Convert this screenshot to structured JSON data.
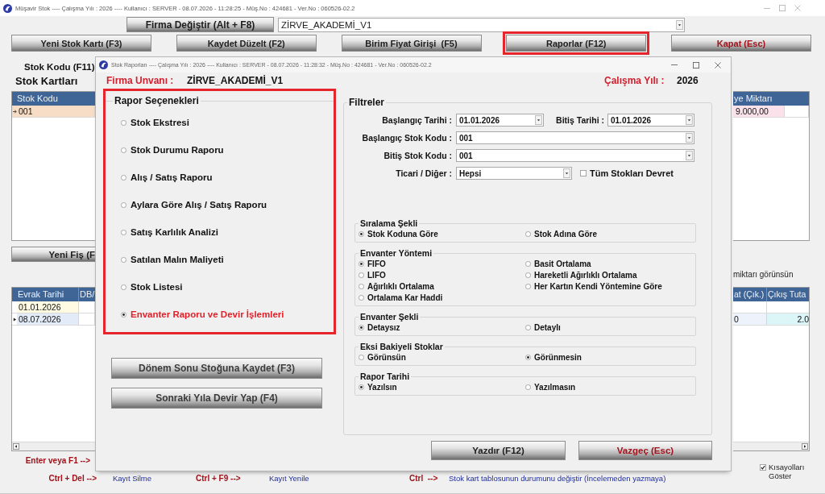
{
  "window": {
    "title": "Müşavir Stok ---- Çalışma Yılı : 2026 ---- Kullanıcı : SERVER - 08.07.2026 - 11:28:25 - Müş.No : 424681 - Ver.No : 060526-02.2"
  },
  "company_bar": {
    "button": "Firma Değiştir (Alt + F8)",
    "company": "ZİRVE_AKADEMİ_V1"
  },
  "toolbar": [
    {
      "label": "Yeni Stok Kartı (F3)",
      "kind": "normal",
      "highlighted": false
    },
    {
      "label": "Kaydet Düzelt (F2)",
      "kind": "normal",
      "highlighted": false
    },
    {
      "label": "Birim Fiyat Girişi  (F5)",
      "kind": "normal",
      "highlighted": false
    },
    {
      "label": "Raporlar (F12)",
      "kind": "normal",
      "highlighted": true
    },
    {
      "label": "Kapat (Esc)",
      "kind": "danger",
      "highlighted": false
    }
  ],
  "stock_code_label": "Stok Kodu (F11)",
  "cards": {
    "title": "Stok Kartları",
    "columns": [
      "Stok Kodu",
      "ye Miktarı"
    ],
    "rows": [
      {
        "cells": [
          "001",
          "9.000,00"
        ],
        "selected": true
      }
    ]
  },
  "new_receipt_button": "Yeni Fiş (F",
  "show_quantity_label": "miktarı görünsün",
  "movements": {
    "columns": [
      "Evrak Tarihi",
      "DB/",
      "at (Çık.)",
      "Çıkış Tuta"
    ],
    "rows": [
      {
        "evrak_tarihi": "01.01.2026",
        "selected": false
      },
      {
        "evrak_tarihi": "08.07.2026",
        "column_3": "0",
        "column_4": "2.0",
        "selected": true
      }
    ]
  },
  "shortcuts": {
    "enter_hint": "Enter veya F1 -->",
    "items": [
      {
        "keys": "Ctrl + Del -->",
        "action": "Kayıt Silme"
      },
      {
        "keys": "Ctrl + F9 -->",
        "action": "Kayıt Yenile"
      },
      {
        "keys": "Ctrl  -->",
        "action": "Stok kart tablosunun durumunu değiştir (İncelemeden yazmaya)"
      }
    ],
    "show_checkbox": {
      "label": "Kısayolları Göster",
      "checked": true
    }
  },
  "dialog": {
    "title": "Stok Raporları ---- Çalışma Yılı : 2026 ---- Kullanıcı : SERVER - 08.07.2026 - 11:28:32 - Müş.No : 424681 - Ver.No : 060526-02.2",
    "company_label": "Firma Unvanı :",
    "company": "ZİRVE_AKADEMİ_V1",
    "year_label": "Çalışma Yılı :",
    "year": "2026",
    "report_options": {
      "title": "Rapor Seçenekleri",
      "highlighted": true,
      "items": [
        {
          "label": "Stok Ekstresi",
          "selected": false
        },
        {
          "label": "Stok Durumu Raporu",
          "selected": false
        },
        {
          "label": "Alış / Satış Raporu",
          "selected": false
        },
        {
          "label": "Aylara Göre Alış / Satış Raporu",
          "selected": false
        },
        {
          "label": "Satış Karlılık Analizi",
          "selected": false
        },
        {
          "label": "Satılan Malın Maliyeti",
          "selected": false
        },
        {
          "label": "Stok Listesi",
          "selected": false
        },
        {
          "label": "Envanter Raporu ve Devir İşlemleri",
          "selected": true
        }
      ]
    },
    "actions": [
      "Dönem Sonu Stoğuna Kaydet (F3)",
      "Sonraki Yıla Devir Yap (F4)"
    ],
    "filters": {
      "title": "Filtreler",
      "start_date": {
        "label": "Başlangıç Tarihi :",
        "value": "01.01.2026"
      },
      "end_date": {
        "label": "Bitiş Tarihi :",
        "value": "01.01.2026"
      },
      "start_code": {
        "label": "Başlangıç Stok Kodu :",
        "value": "001"
      },
      "end_code": {
        "label": "Bitiş Stok Kodu :",
        "value": "001"
      },
      "type": {
        "label": "Ticari / Diğer :",
        "value": "Hepsi"
      },
      "transfer_all": {
        "label": "Tüm Stokları Devret",
        "checked": false
      },
      "groups": [
        {
          "title": "Sıralama Şekli",
          "options": [
            {
              "label": "Stok Koduna Göre",
              "selected": true
            },
            {
              "label": "Stok Adına Göre",
              "selected": false
            }
          ]
        },
        {
          "title": "Envanter Yöntemi",
          "options": [
            {
              "label": "FIFO",
              "selected": true
            },
            {
              "label": "Basit Ortalama",
              "selected": false
            },
            {
              "label": "LIFO",
              "selected": false
            },
            {
              "label": "Hareketli Ağırlıklı Ortalama",
              "selected": false
            },
            {
              "label": "Ağırlıklı Ortalama",
              "selected": false
            },
            {
              "label": "Her Kartın Kendi Yöntemine Göre",
              "selected": false
            },
            {
              "label": "Ortalama Kar Haddi",
              "selected": false
            }
          ]
        },
        {
          "title": "Envanter Şekli",
          "options": [
            {
              "label": "Detaysız",
              "selected": true
            },
            {
              "label": "Detaylı",
              "selected": false
            }
          ]
        },
        {
          "title": "Eksi Bakiyeli Stoklar",
          "options": [
            {
              "label": "Görünsün",
              "selected": false
            },
            {
              "label": "Görünmesin",
              "selected": true
            }
          ]
        },
        {
          "title": "Rapor Tarihi",
          "options": [
            {
              "label": "Yazılsın",
              "selected": true
            },
            {
              "label": "Yazılmasın",
              "selected": false
            }
          ]
        }
      ]
    },
    "buttons": [
      {
        "label": "Yazdır (F12)",
        "kind": "normal"
      },
      {
        "label": "Vazgeç (Esc)",
        "kind": "danger"
      }
    ]
  }
}
